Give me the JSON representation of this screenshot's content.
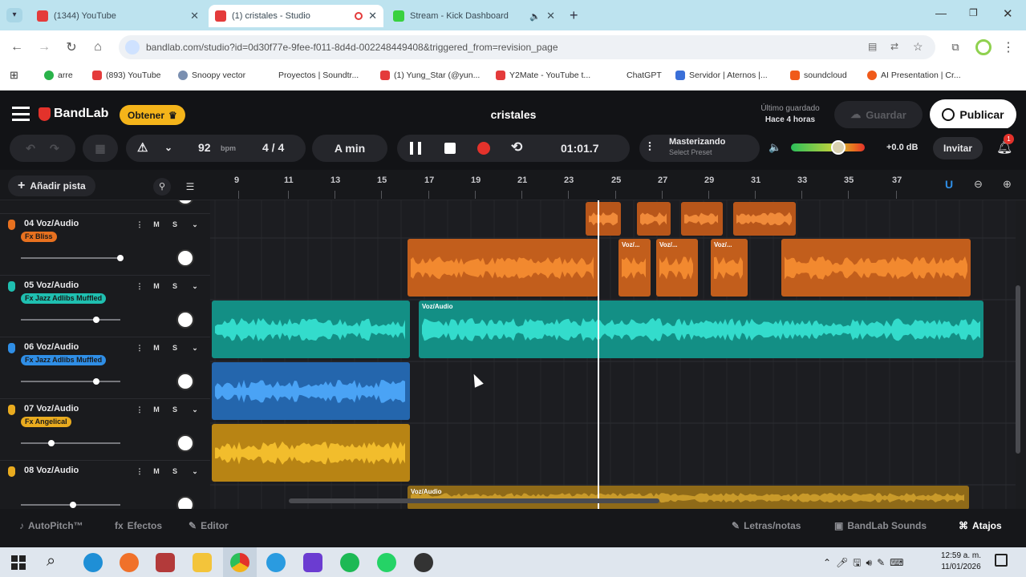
{
  "browser": {
    "tabs": [
      {
        "title": "(1344) YouTube",
        "color": "#e43b3b",
        "active": false
      },
      {
        "title": "(1) cristales - Studio",
        "color": "#e43b3b",
        "active": true
      },
      {
        "title": "Stream - Kick Dashboard",
        "color": "#38d13f",
        "active": false
      }
    ],
    "url": "bandlab.com/studio?id=0d30f77e-9fee-f011-8d4d-002248449408&triggered_from=revision_page",
    "bookmarks": [
      {
        "label": "arre",
        "color": "#2ab34a"
      },
      {
        "label": "(893) YouTube",
        "color": "#e43b3b"
      },
      {
        "label": "Snoopy vector",
        "color": "#7a8fb0"
      },
      {
        "label": "Proyectos | Soundtr...",
        "color": "#ffffff"
      },
      {
        "label": "(1) Yung_Star (@yun...",
        "color": "#e43b3b"
      },
      {
        "label": "Y2Mate - YouTube t...",
        "color": "#e43b3b"
      },
      {
        "label": "ChatGPT",
        "color": "#ffffff"
      },
      {
        "label": "Servidor | Aternos |...",
        "color": "#3a6fd8"
      },
      {
        "label": "soundcloud",
        "color": "#f05a1a"
      },
      {
        "label": "AI Presentation | Cr...",
        "color": "#f05a1a"
      }
    ]
  },
  "header": {
    "brand": "BandLab",
    "get_label": "Obtener",
    "project": "cristales",
    "last_saved_line1": "Último guardado",
    "last_saved_line2": "Hace 4 horas",
    "save_label": "Guardar",
    "publish_label": "Publicar"
  },
  "toolbar": {
    "bpm": "92",
    "bpm_unit": "bpm",
    "time_sig": "4 / 4",
    "key": "A min",
    "time": "01:01.7",
    "mastering": "Masterizando",
    "preset": "Select Preset",
    "volume_db": "+0.0 dB",
    "invite": "Invitar",
    "notif_count": "1"
  },
  "ruler": {
    "add_track": "Añadir pista",
    "bars": [
      "9",
      "11",
      "13",
      "15",
      "17",
      "19",
      "21",
      "23",
      "25",
      "27",
      "29",
      "31",
      "33",
      "35",
      "37"
    ]
  },
  "tracks": [
    {
      "name": "04 Voz/Audio",
      "fx": "Fx Bliss",
      "color": "#e8711f",
      "vol": 0.98
    },
    {
      "name": "05 Voz/Audio",
      "fx": "Fx Jazz Adlibs Muffled",
      "color": "#1fbfb0",
      "vol": 0.74
    },
    {
      "name": "06 Voz/Audio",
      "fx": "Fx Jazz Adlibs Muffled",
      "color": "#2f8ee6",
      "vol": 0.74
    },
    {
      "name": "07 Voz/Audio",
      "fx": "Fx Angelical",
      "color": "#e9ab1f",
      "vol": 0.28
    },
    {
      "name": "08 Voz/Audio",
      "fx": "",
      "color": "#e9ab1f",
      "vol": 0.5
    }
  ],
  "clip_label": "Voz/Audio",
  "short_clip_label": "Voz/...",
  "bottom": {
    "autopitch": "AutoPitch™",
    "effects": "Efectos",
    "editor": "Editor",
    "lyrics": "Letras/notas",
    "sounds": "BandLab Sounds",
    "shortcuts": "Atajos"
  },
  "taskbar": {
    "time": "12:59 a. m.",
    "date": "11/01/2026"
  },
  "colors": {
    "accent": "#e3322b",
    "brand_yellow": "#f4b41a",
    "teal": "#1fbfb0",
    "orange": "#e8711f",
    "blue": "#2f8ee6",
    "gold": "#e9ab1f"
  }
}
